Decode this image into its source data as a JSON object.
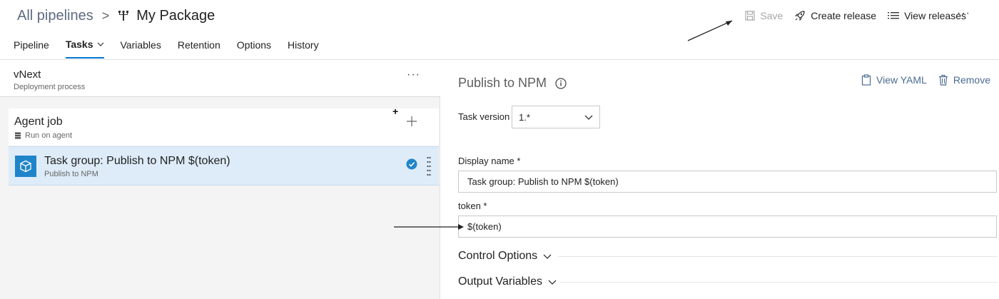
{
  "breadcrumb": {
    "root": "All pipelines",
    "separator": ">",
    "title": "My Package"
  },
  "toolbar": {
    "save": "Save",
    "create_release": "Create release",
    "view_releases": "View releases",
    "more": "···"
  },
  "tabs": [
    {
      "label": "Pipeline"
    },
    {
      "label": "Tasks"
    },
    {
      "label": "Variables"
    },
    {
      "label": "Retention"
    },
    {
      "label": "Options"
    },
    {
      "label": "History"
    }
  ],
  "stage": {
    "name": "vNext",
    "subtitle": "Deployment process",
    "more": "···"
  },
  "agent_job": {
    "name": "Agent job",
    "subtitle": "Run on agent",
    "plus_marker": "+"
  },
  "task": {
    "name": "Task group: Publish to NPM $(token)",
    "subtitle": "Publish to NPM"
  },
  "panel": {
    "title": "Publish to NPM",
    "view_yaml": "View YAML",
    "remove": "Remove",
    "task_version_label": "Task version",
    "task_version_value": "1.*",
    "display_name_label": "Display name *",
    "display_name_value": "Task group: Publish to NPM $(token)",
    "token_label": "token *",
    "token_value": "$(token)",
    "control_options": "Control Options",
    "output_variables": "Output Variables"
  },
  "colors": {
    "accent": "#0078d4",
    "selected_row": "#deecf9",
    "task_icon": "#1f85c8",
    "link": "#4b6b91"
  }
}
